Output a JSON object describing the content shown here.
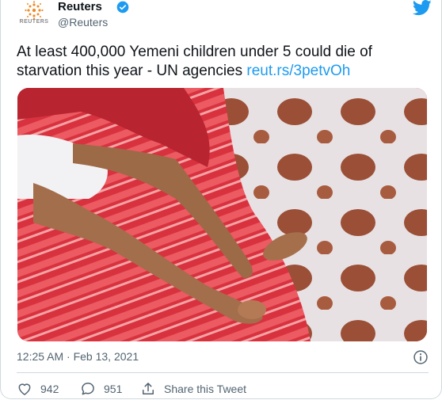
{
  "author": {
    "name": "Reuters",
    "handle": "@Reuters",
    "avatar_text": "REUTERS",
    "verified_icon": "verified-badge-icon"
  },
  "tweet": {
    "text": "At least 400,000 Yemeni children under 5 could die of starvation this year - UN agencies ",
    "link": "reut.rs/3petvOh",
    "photo_icon": "photo-image"
  },
  "meta": {
    "timestamp": "12:25 AM · Feb 13, 2021"
  },
  "actions": {
    "likes": "942",
    "replies": "951",
    "share_label": "Share this Tweet"
  },
  "colors": {
    "brand": "#1d9bf0",
    "muted": "#536471",
    "border": "#cfd9de"
  }
}
